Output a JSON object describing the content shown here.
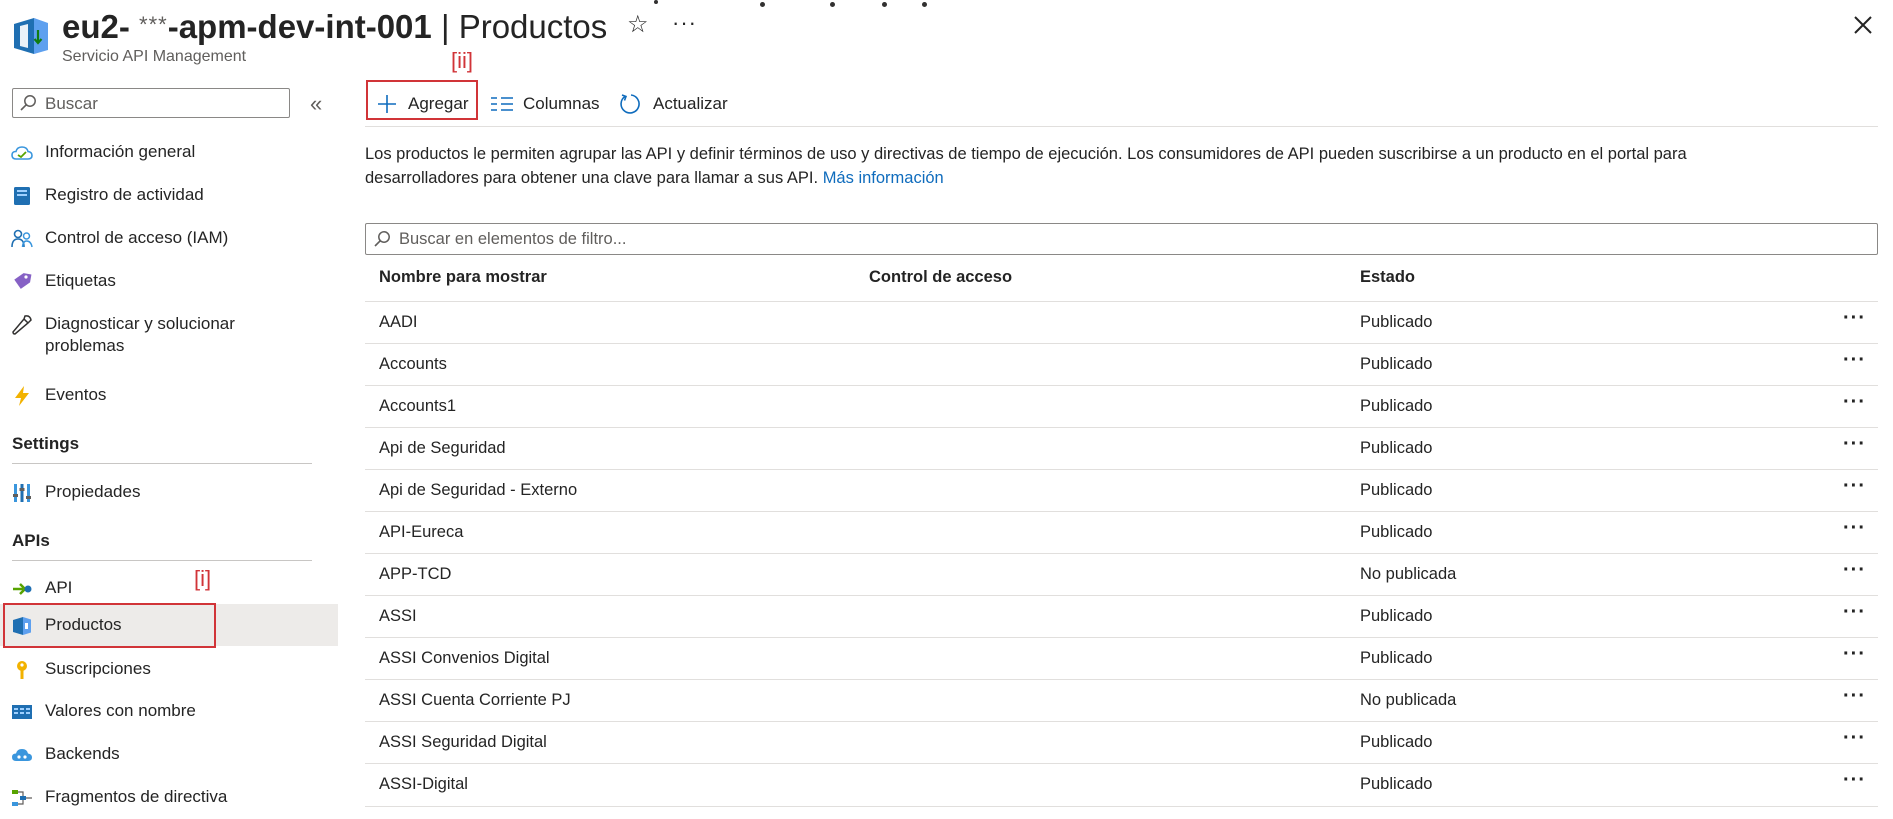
{
  "header": {
    "title_prefix": "eu2-",
    "title_mask": "***",
    "title_suffix": "-apm-dev-int-001",
    "title_separator": " | ",
    "page_title": "Productos",
    "subtitle": "Servicio API Management",
    "star_icon": "☆",
    "more_label": "···"
  },
  "sidebar": {
    "search_placeholder": "Buscar",
    "collapse_label": "«",
    "items": [
      {
        "label": "Información general",
        "icon": "cloud-overview-icon"
      },
      {
        "label": "Registro de actividad",
        "icon": "activity-log-icon"
      },
      {
        "label": "Control de acceso (IAM)",
        "icon": "iam-icon"
      },
      {
        "label": "Etiquetas",
        "icon": "tag-icon"
      },
      {
        "label": "Diagnosticar y solucionar problemas",
        "icon": "wrench-icon"
      },
      {
        "label": "Eventos",
        "icon": "lightning-icon"
      }
    ],
    "section_settings": "Settings",
    "settings_items": [
      {
        "label": "Propiedades",
        "icon": "properties-icon"
      }
    ],
    "section_apis": "APIs",
    "apis_items": [
      {
        "label": "API",
        "icon": "api-icon"
      },
      {
        "label": "Productos",
        "icon": "products-icon",
        "selected": true
      },
      {
        "label": "Suscripciones",
        "icon": "key-icon"
      },
      {
        "label": "Valores con nombre",
        "icon": "named-values-icon"
      },
      {
        "label": "Backends",
        "icon": "backends-icon"
      },
      {
        "label": "Fragmentos de directiva",
        "icon": "policy-fragments-icon"
      }
    ]
  },
  "annotations": {
    "i": "[i]",
    "ii": "[ii]"
  },
  "toolbar": {
    "add_label": "Agregar",
    "columns_label": "Columnas",
    "refresh_label": "Actualizar"
  },
  "description": {
    "text": "Los productos le permiten agrupar las API y definir términos de uso y directivas de tiempo de ejecución. Los consumidores de API pueden suscribirse a un producto en el portal para desarrolladores para obtener una clave para llamar a sus API. ",
    "link": "Más información"
  },
  "filter": {
    "placeholder": "Buscar en elementos de filtro..."
  },
  "table": {
    "columns": [
      "Nombre para mostrar",
      "Control de acceso",
      "Estado"
    ],
    "rows": [
      {
        "name": "AADI",
        "access": "",
        "status": "Publicado"
      },
      {
        "name": "Accounts",
        "access": "",
        "status": "Publicado"
      },
      {
        "name": "Accounts1",
        "access": "",
        "status": "Publicado"
      },
      {
        "name": "Api de Seguridad",
        "access": "",
        "status": "Publicado"
      },
      {
        "name": "Api de Seguridad - Externo",
        "access": "",
        "status": "Publicado"
      },
      {
        "name": "API-Eureca",
        "access": "",
        "status": "Publicado"
      },
      {
        "name": "APP-TCD",
        "access": "",
        "status": "No publicada"
      },
      {
        "name": "ASSI",
        "access": "",
        "status": "Publicado"
      },
      {
        "name": "ASSI Convenios Digital",
        "access": "",
        "status": "Publicado"
      },
      {
        "name": "ASSI Cuenta Corriente PJ",
        "access": "",
        "status": "No publicada"
      },
      {
        "name": "ASSI Seguridad Digital",
        "access": "",
        "status": "Publicado"
      },
      {
        "name": "ASSI-Digital",
        "access": "",
        "status": "Publicado"
      }
    ],
    "row_more_label": "···"
  },
  "colors": {
    "accent": "#0f6cbd",
    "annotation": "#d13438",
    "selected_bg": "#edebe9"
  }
}
